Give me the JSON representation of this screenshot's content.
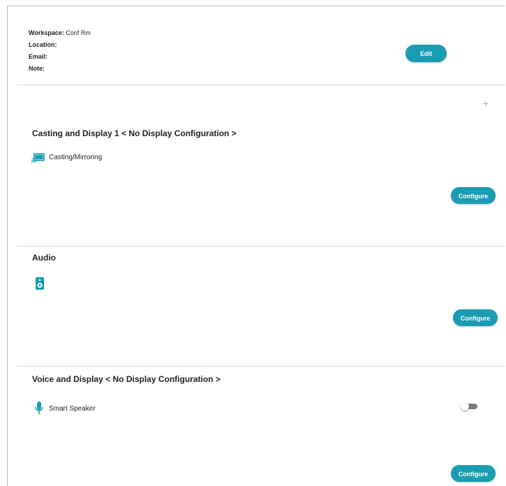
{
  "workspace": {
    "workspace_label": "Workspace:",
    "workspace_value": "Conf Rm",
    "location_label": "Location:",
    "location_value": "",
    "email_label": "Email:",
    "email_value": "",
    "note_label": "Note:",
    "note_value": "",
    "edit_label": "Edit"
  },
  "casting": {
    "heading": "Casting and Display 1 < No Display Configuration >",
    "item_label": "Casting/Mirroring",
    "item_icon": "cast-screen-icon",
    "add_symbol": "+",
    "configure_label": "Configure"
  },
  "audio": {
    "heading": "Audio",
    "item_icon": "speaker-icon",
    "configure_label": "Configure"
  },
  "voice": {
    "heading": "Voice and Display < No Display Configuration >",
    "item_label": "Smart Speaker",
    "item_icon": "microphone-icon",
    "toggle_on": false,
    "configure_label": "Configure"
  },
  "colors": {
    "accent": "#1a9cb3",
    "text": "#222222",
    "divider": "#dadada"
  }
}
